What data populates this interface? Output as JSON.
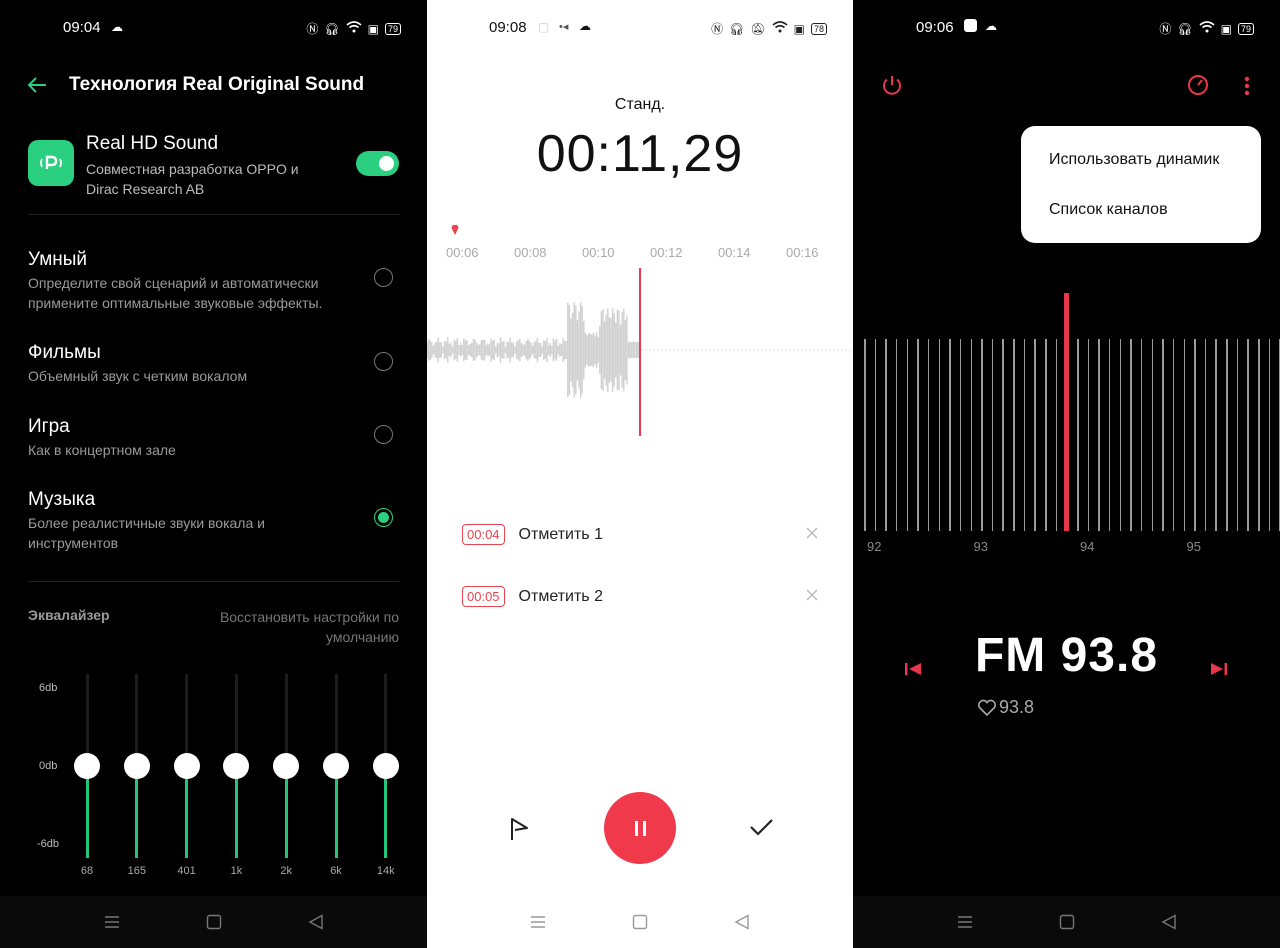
{
  "panel1": {
    "status": {
      "time": "09:04",
      "battery": "79"
    },
    "header": {
      "title": "Технология Real Original Sound"
    },
    "feature": {
      "title": "Real HD Sound",
      "desc_line1": "Совместная разработка OPPO и",
      "desc_line2": "Dirac Research AB",
      "enabled": true
    },
    "options": [
      {
        "title": "Умный",
        "desc1": "Определите свой сценарий и автоматически",
        "desc2": "примените оптимальные звуковые эффекты.",
        "selected": false
      },
      {
        "title": "Фильмы",
        "desc1": "Объемный звук с четким вокалом",
        "desc2": "",
        "selected": false
      },
      {
        "title": "Игра",
        "desc1": "Как в концертном зале",
        "desc2": "",
        "selected": false
      },
      {
        "title": "Музыка",
        "desc1": "Более реалистичные звуки вокала и",
        "desc2": "инструментов",
        "selected": true
      }
    ],
    "equalizer": {
      "title": "Эквалайзер",
      "reset_line1": "Восстановить настройки по",
      "reset_line2": "умолчанию",
      "db_top": "6db",
      "db_mid": "0db",
      "db_bottom": "-6db",
      "bands": [
        "68",
        "165",
        "401",
        "1k",
        "2k",
        "6k",
        "14k"
      ]
    }
  },
  "panel2": {
    "status": {
      "time": "09:08",
      "battery": "78"
    },
    "mode": "Станд.",
    "timer": "00:11,29",
    "ticks": [
      "00:06",
      "00:08",
      "00:10",
      "00:12",
      "00:14",
      "00:16"
    ],
    "marks": [
      {
        "time": "00:04",
        "label": "Отметить 1"
      },
      {
        "time": "00:05",
        "label": "Отметить 2"
      }
    ],
    "accent": "#f0394a"
  },
  "panel3": {
    "status": {
      "time": "09:06",
      "battery": "79"
    },
    "menu": {
      "item1": "Использовать динамик",
      "item2": "Список каналов"
    },
    "scale_numbers": [
      "92",
      "93",
      "94",
      "95"
    ],
    "station": "FM 93.8",
    "favorite": "93.8",
    "accent": "#e8364a"
  }
}
